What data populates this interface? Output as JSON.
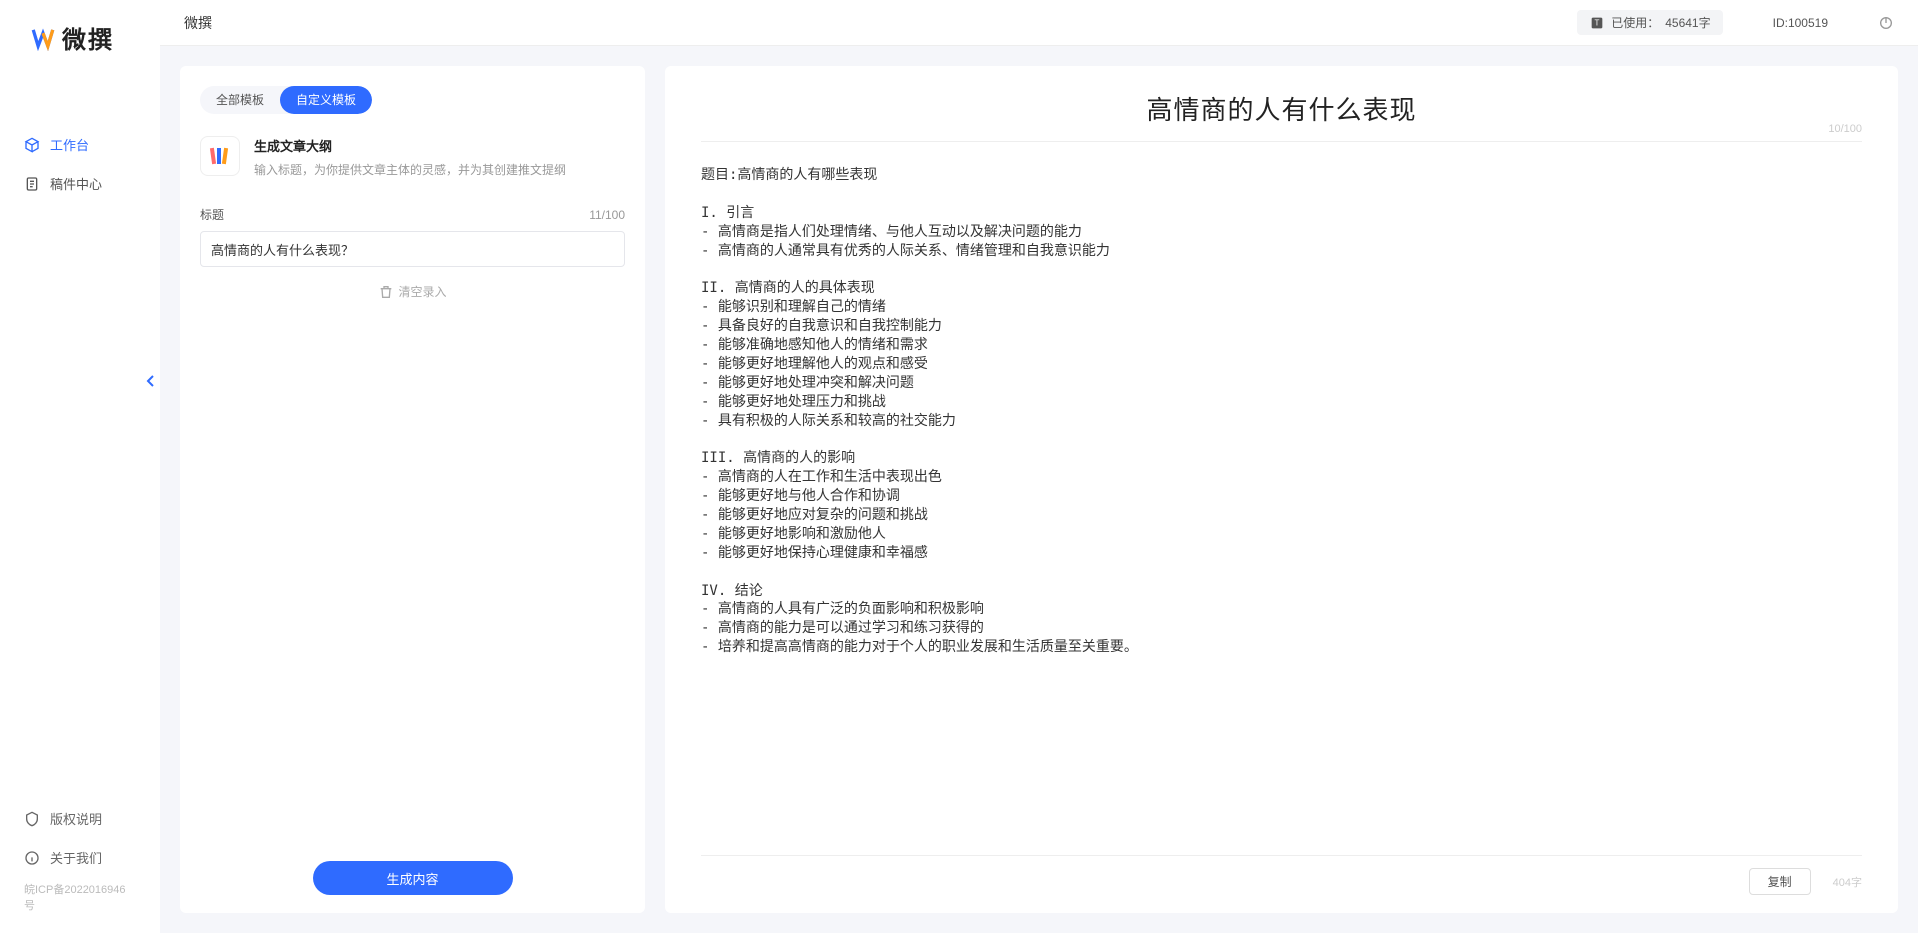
{
  "brand": {
    "name": "微撰"
  },
  "topbar": {
    "title": "微撰",
    "usage_label": "已使用：",
    "usage_value": "45641字",
    "id_label": "ID:",
    "id_value": "100519"
  },
  "sidebar": {
    "items": [
      {
        "label": "工作台",
        "active": true
      },
      {
        "label": "稿件中心",
        "active": false
      }
    ],
    "footer": [
      {
        "label": "版权说明"
      },
      {
        "label": "关于我们"
      }
    ],
    "icp": "皖ICP备2022016946号"
  },
  "left": {
    "tabs": [
      {
        "label": "全部模板",
        "active": false
      },
      {
        "label": "自定义模板",
        "active": true
      }
    ],
    "template": {
      "title": "生成文章大纲",
      "desc": "输入标题，为你提供文章主体的灵感，并为其创建推文提纲"
    },
    "field": {
      "label": "标题",
      "count": "11/100",
      "value": "高情商的人有什么表现？"
    },
    "clear": "清空录入",
    "generate": "生成内容"
  },
  "output": {
    "title": "高情商的人有什么表现",
    "title_count": "10/100",
    "body": "题目:高情商的人有哪些表现\n\nI. 引言\n- 高情商是指人们处理情绪、与他人互动以及解决问题的能力\n- 高情商的人通常具有优秀的人际关系、情绪管理和自我意识能力\n\nII. 高情商的人的具体表现\n- 能够识别和理解自己的情绪\n- 具备良好的自我意识和自我控制能力\n- 能够准确地感知他人的情绪和需求\n- 能够更好地理解他人的观点和感受\n- 能够更好地处理冲突和解决问题\n- 能够更好地处理压力和挑战\n- 具有积极的人际关系和较高的社交能力\n\nIII. 高情商的人的影响\n- 高情商的人在工作和生活中表现出色\n- 能够更好地与他人合作和协调\n- 能够更好地应对复杂的问题和挑战\n- 能够更好地影响和激励他人\n- 能够更好地保持心理健康和幸福感\n\nIV. 结论\n- 高情商的人具有广泛的负面影响和积极影响\n- 高情商的能力是可以通过学习和练习获得的\n- 培养和提高高情商的能力对于个人的职业发展和生活质量至关重要。",
    "copy": "复制",
    "word_count": "404字"
  }
}
